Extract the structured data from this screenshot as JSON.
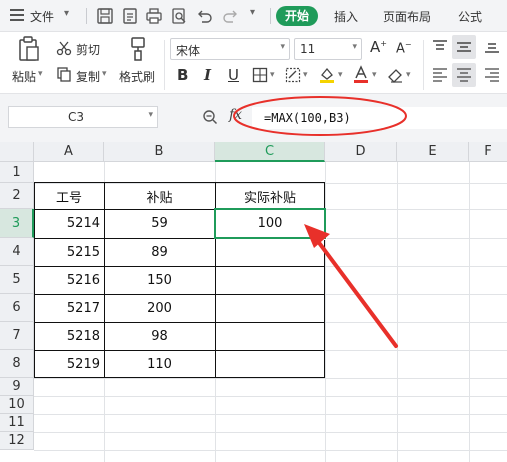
{
  "menubar": {
    "file_label": "文件",
    "tabs": [
      "开始",
      "插入",
      "页面布局",
      "公式"
    ],
    "accent": "#1f9b5a"
  },
  "ribbon": {
    "cut": "剪切",
    "paste": "粘贴",
    "copy": "复制",
    "format_painter": "格式刷",
    "font_name": "宋体",
    "font_size": "11"
  },
  "formula_bar": {
    "name_box": "C3",
    "fx_label": "fx",
    "formula": "=MAX(100,B3)"
  },
  "sheet": {
    "columns": [
      "A",
      "B",
      "C",
      "D",
      "E",
      "F"
    ],
    "rows": [
      "1",
      "2",
      "3",
      "4",
      "5",
      "6",
      "7",
      "8",
      "9",
      "10",
      "11",
      "12"
    ],
    "selected_cell": "C3",
    "table": {
      "headers": [
        "工号",
        "补贴",
        "实际补贴"
      ],
      "rows": [
        [
          "5214",
          "59",
          "100"
        ],
        [
          "5215",
          "89",
          ""
        ],
        [
          "5216",
          "150",
          ""
        ],
        [
          "5217",
          "200",
          ""
        ],
        [
          "5218",
          "98",
          ""
        ],
        [
          "5219",
          "110",
          ""
        ]
      ]
    }
  },
  "annotation": {
    "color": "#e8302a"
  }
}
